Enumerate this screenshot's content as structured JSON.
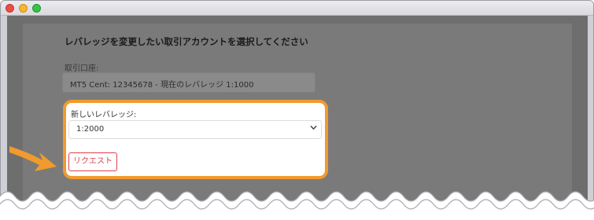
{
  "window": {
    "controls": [
      "close",
      "minimize",
      "zoom"
    ]
  },
  "form": {
    "heading": "レバレッジを変更したい取引アカウントを選択してください",
    "account_label": "取引口座:",
    "account_value": "MT5 Cent: 12345678 - 現在のレバレッジ 1:1000",
    "new_leverage_label": "新しいレバレッジ:",
    "new_leverage_value": "1:2000",
    "request_button": "リクエスト"
  },
  "colors": {
    "highlight_border": "#f19a2d",
    "button_accent": "#e0404b",
    "arrow": "#f19a2d",
    "overlay": "#6e6e6e"
  },
  "icons": {
    "dropdown": "chevron-down-icon",
    "pointer": "orange-arrow-icon"
  }
}
